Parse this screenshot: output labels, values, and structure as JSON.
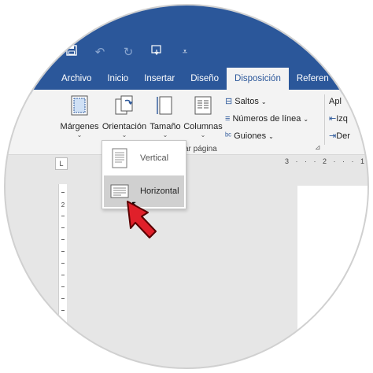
{
  "quick_access": {
    "save_icon": "save-icon",
    "undo_icon": "undo-icon",
    "redo_icon": "redo-icon",
    "touch_icon": "touch-mode-icon",
    "customize_icon": "customize-qat-icon"
  },
  "tabs": [
    {
      "label": "Archivo"
    },
    {
      "label": "Inicio"
    },
    {
      "label": "Insertar"
    },
    {
      "label": "Diseño"
    },
    {
      "label": "Disposición"
    },
    {
      "label": "Referen"
    }
  ],
  "ribbon": {
    "margenes": "Márgenes",
    "orientacion": "Orientación",
    "tamano": "Tamaño",
    "columnas": "Columnas",
    "saltos": "Saltos",
    "numeros_linea": "Números de línea",
    "guiones": "Guiones",
    "group_label": "ar página",
    "apl": "Apl",
    "izq": "Izq",
    "der": "Der"
  },
  "orientation_menu": {
    "vertical": "Vertical",
    "horizontal": "Horizontal"
  },
  "rulers": {
    "corner": "L",
    "h_marks": "3 · · · 2 · · · 1",
    "v_mark": "2"
  },
  "colors": {
    "word_blue": "#2b579a",
    "arrow_red": "#e0202a"
  }
}
